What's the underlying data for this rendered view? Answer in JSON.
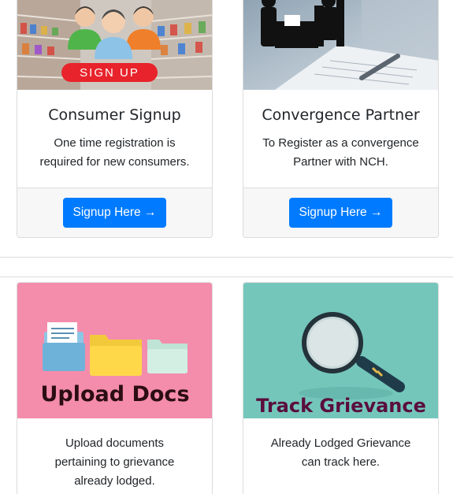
{
  "cards": [
    {
      "title": "Consumer Signup",
      "text_line1": "One time registration is",
      "text_line2": "required for new consumers.",
      "button_label": "Signup Here →",
      "image_caption": "SIGN UP"
    },
    {
      "title": "Convergence Partner",
      "text_line1": "To Register as a convergence",
      "text_line2": "Partner with NCH.",
      "button_label": "Signup Here →"
    },
    {
      "text_line1": "Upload documents",
      "text_line2": "pertaining to grievance",
      "text_line3": "already lodged.",
      "image_caption": "Upload Docs"
    },
    {
      "text_line1": "Already Lodged Grievance",
      "text_line2": "can track here.",
      "image_caption": "Track Grievance"
    }
  ],
  "colors": {
    "primary": "#007bff",
    "upload_bg": "#f48cab",
    "track_bg": "#74c6bb",
    "signup_banner": "#e8232b"
  }
}
